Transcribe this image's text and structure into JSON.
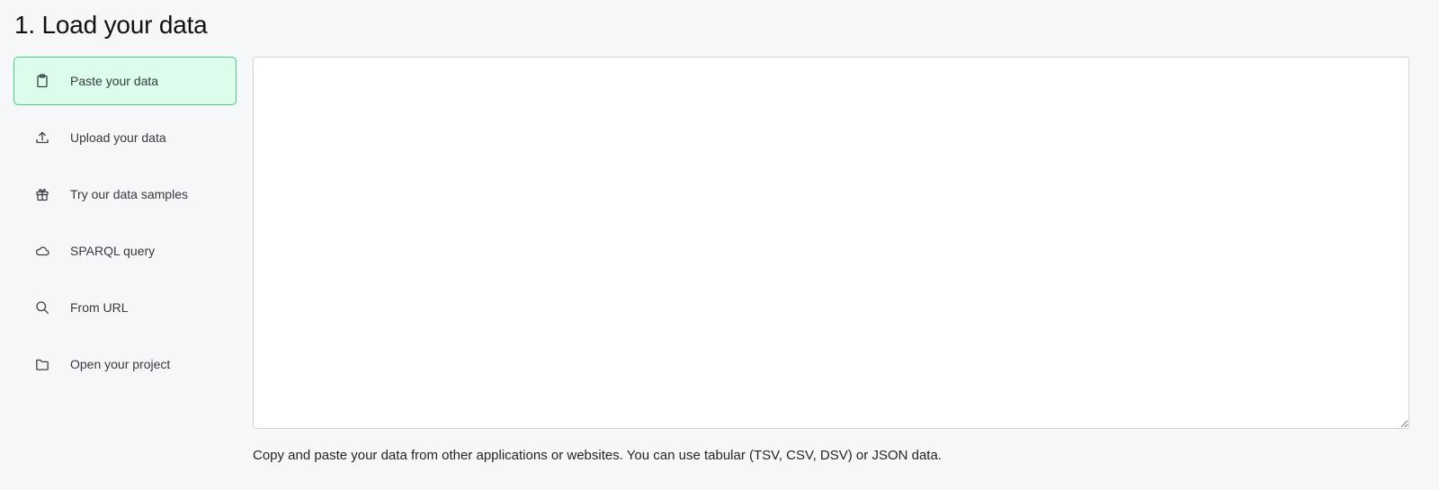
{
  "header": {
    "title": "1. Load your data"
  },
  "sidebar": {
    "items": [
      {
        "label": "Paste your data",
        "icon": "clipboard-icon",
        "active": true
      },
      {
        "label": "Upload your data",
        "icon": "upload-icon",
        "active": false
      },
      {
        "label": "Try our data samples",
        "icon": "gift-icon",
        "active": false
      },
      {
        "label": "SPARQL query",
        "icon": "cloud-icon",
        "active": false
      },
      {
        "label": "From URL",
        "icon": "search-icon",
        "active": false
      },
      {
        "label": "Open your project",
        "icon": "folder-icon",
        "active": false
      }
    ]
  },
  "main": {
    "paste_value": "",
    "help": "Copy and paste your data from other applications or websites. You can use tabular (TSV, CSV, DSV) or JSON data."
  },
  "colors": {
    "active_bg": "#dcfcec",
    "active_border": "#4fc985",
    "page_bg": "#f6f7f9"
  }
}
